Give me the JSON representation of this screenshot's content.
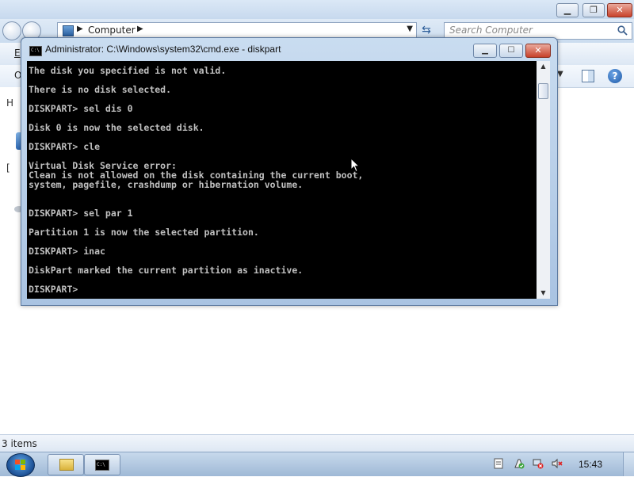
{
  "explorer": {
    "address": "Computer",
    "search_placeholder": "Search Computer",
    "status": "3 items",
    "menu_partial": "E",
    "toolbar_partial": "O",
    "left_partial_1": "H",
    "left_partial_2": "["
  },
  "cmd": {
    "title": "Administrator: C:\\Windows\\system32\\cmd.exe - diskpart",
    "icon_text": "C:\\",
    "lines": [
      "The disk you specified is not valid.",
      "",
      "There is no disk selected.",
      "",
      "DISKPART> sel dis 0",
      "",
      "Disk 0 is now the selected disk.",
      "",
      "DISKPART> cle",
      "",
      "Virtual Disk Service error:",
      "Clean is not allowed on the disk containing the current boot,",
      "system, pagefile, crashdump or hibernation volume.",
      "",
      "",
      "DISKPART> sel par 1",
      "",
      "Partition 1 is now the selected partition.",
      "",
      "DISKPART> inac",
      "",
      "DiskPart marked the current partition as inactive.",
      "",
      "DISKPART> "
    ]
  },
  "taskbar": {
    "clock": "15:43"
  }
}
